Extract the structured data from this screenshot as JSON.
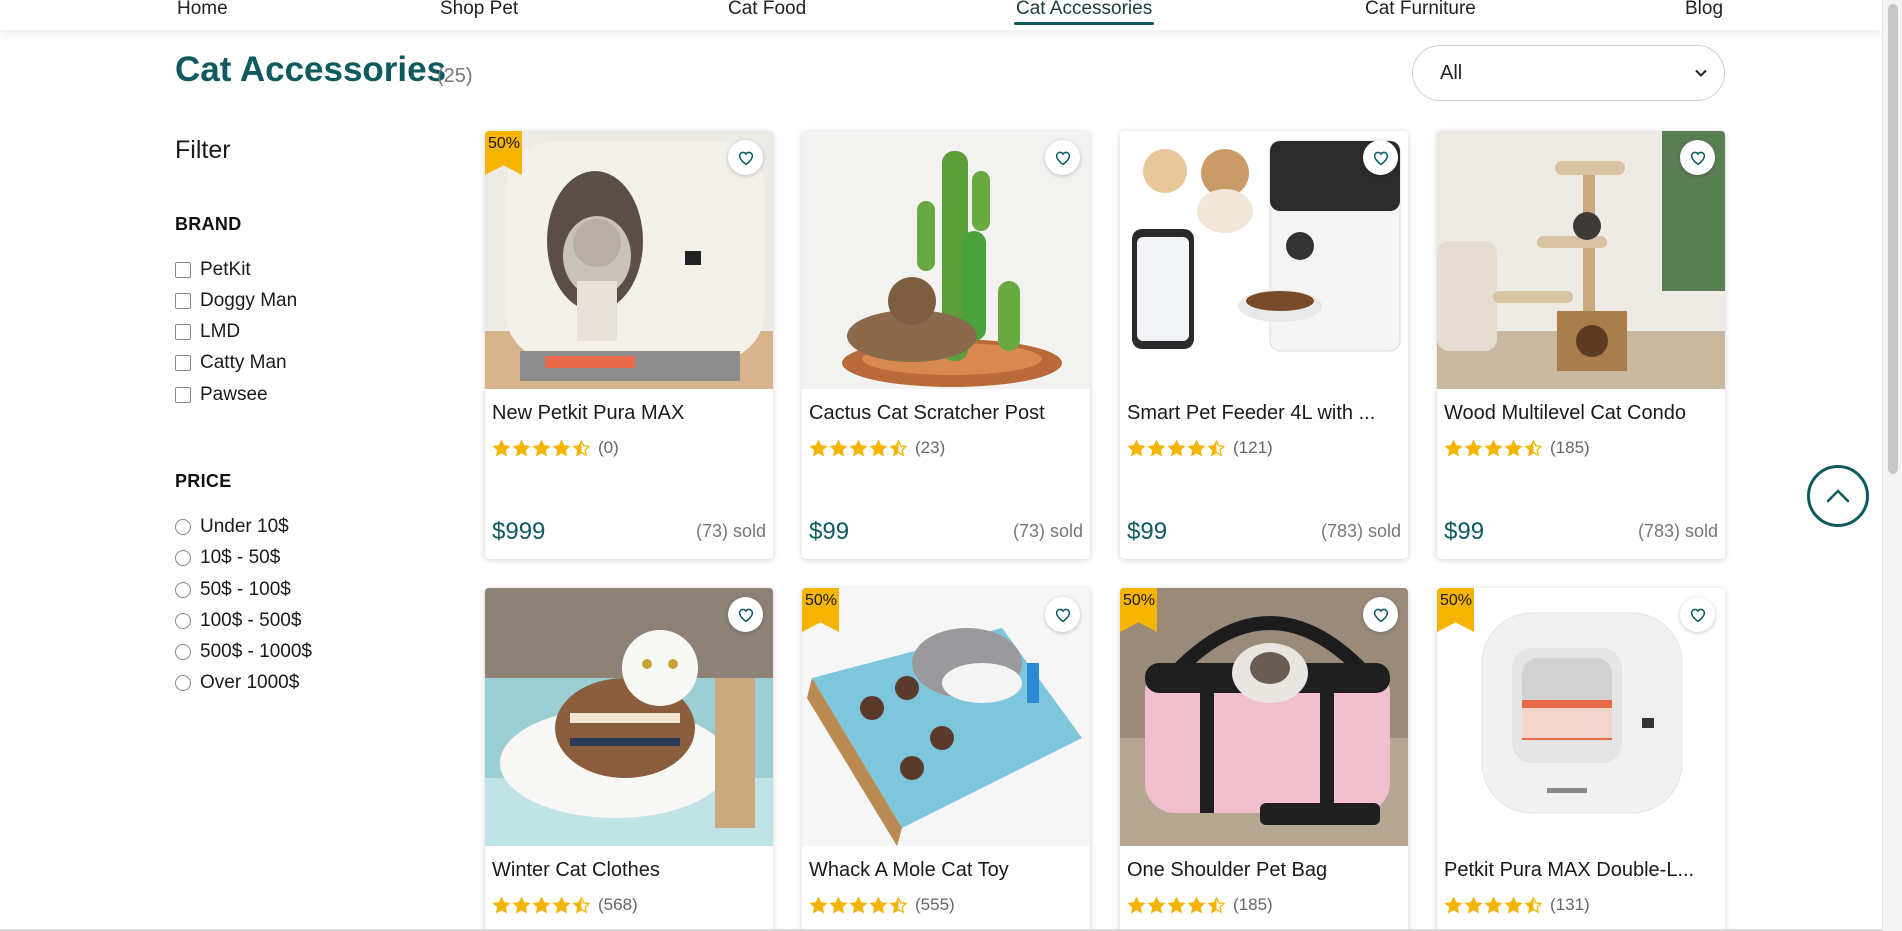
{
  "nav": {
    "links": [
      "Home",
      "Shop Pet",
      "Cat Food",
      "Cat Accessories",
      "Cat Furniture",
      "Blog"
    ],
    "active_index": 3
  },
  "header": {
    "title": "Cat Accessories",
    "count": "(25)",
    "sort_value": "All"
  },
  "filter": {
    "title": "Filter",
    "brand": {
      "title": "BRAND",
      "options": [
        "PetKit",
        "Doggy Man",
        "LMD",
        "Catty Man",
        "Pawsee"
      ]
    },
    "price": {
      "title": "PRICE",
      "options": [
        "Under 10$",
        "10$ - 50$",
        "50$ - 100$",
        "100$ - 500$",
        "500$ - 1000$",
        "Over 1000$"
      ]
    }
  },
  "products": [
    {
      "name": "New Petkit Pura MAX",
      "reviews": "(0)",
      "price": "$999",
      "sold": "(73) sold",
      "badge": "50%",
      "rating": 4.5,
      "image": "white-litter-box-with-cat"
    },
    {
      "name": "Cactus Cat Scratcher Post",
      "reviews": "(23)",
      "price": "$99",
      "sold": "(73) sold",
      "badge": "",
      "rating": 4.5,
      "image": "cactus-scratcher-with-tabby-cat"
    },
    {
      "name": "Smart Pet Feeder 4L with ...",
      "reviews": "(121)",
      "price": "$99",
      "sold": "(783) sold",
      "badge": "",
      "rating": 4.5,
      "image": "smart-feeder-with-phone-cat-dog"
    },
    {
      "name": "Wood Multilevel Cat Condo",
      "reviews": "(185)",
      "price": "$99",
      "sold": "(783) sold",
      "badge": "",
      "rating": 4.5,
      "image": "cat-tree-condo"
    },
    {
      "name": "Winter Cat Clothes",
      "reviews": "(568)",
      "badge": "",
      "rating": 4.5,
      "image": "white-cat-in-sweater"
    },
    {
      "name": "Whack A Mole Cat Toy",
      "reviews": "(555)",
      "badge": "50%",
      "rating": 4.5,
      "image": "whack-a-mole-toy-box"
    },
    {
      "name": "One Shoulder Pet Bag",
      "reviews": "(185)",
      "badge": "50%",
      "rating": 4.5,
      "image": "pink-pet-carrier-bag"
    },
    {
      "name": "Petkit Pura MAX Double-L...",
      "reviews": "(131)",
      "badge": "50%",
      "rating": 4.5,
      "image": "white-litter-box"
    }
  ],
  "colors": {
    "accent": "#0e5a5e",
    "star": "#f4b400",
    "badge": "#f4b400"
  },
  "icons": {
    "favorite": "heart-outline-icon",
    "back_to_top": "chevron-up-icon",
    "sort": "chevron-down-icon"
  }
}
